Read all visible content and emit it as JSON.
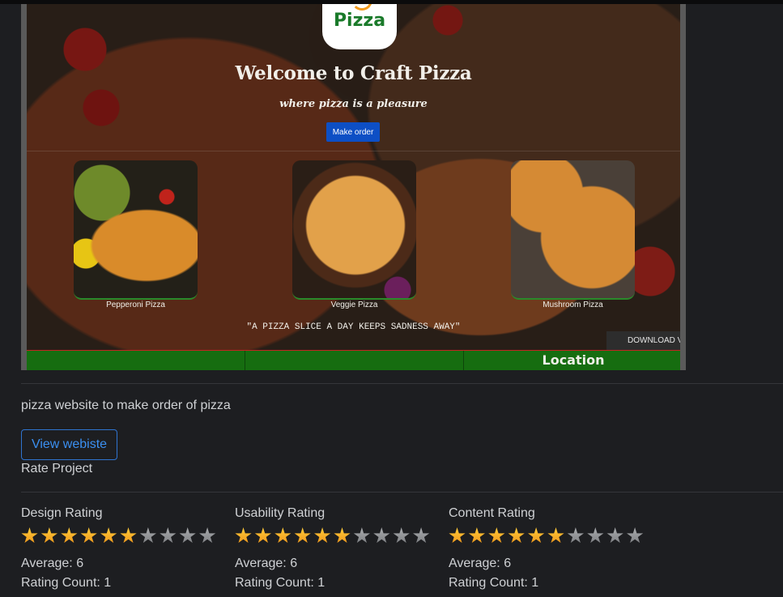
{
  "preview": {
    "logo_text": "Pizza",
    "welcome": "Welcome to Craft Pizza",
    "tagline": "where pizza is a pleasure",
    "make_order": "Make order",
    "cards": [
      {
        "label": "Pepperoni Pizza"
      },
      {
        "label": "Veggie Pizza"
      },
      {
        "label": "Mushroom Pizza"
      }
    ],
    "quote": "\"A PIZZA SLICE A DAY KEEPS SADNESS AWAY\"",
    "download": "DOWNLOAD V",
    "location": "Location"
  },
  "project": {
    "description": "pizza website to make order of pizza",
    "view_button": "View webiste",
    "rate_title": "Rate Project"
  },
  "ratings": [
    {
      "title": "Design Rating",
      "filled": 6,
      "max": 10,
      "average": "Average: 6",
      "count": "Rating Count: 1"
    },
    {
      "title": "Usability Rating",
      "filled": 6,
      "max": 10,
      "average": "Average: 6",
      "count": "Rating Count: 1"
    },
    {
      "title": "Content Rating",
      "filled": 6,
      "max": 10,
      "average": "Average: 6",
      "count": "Rating Count: 1"
    }
  ],
  "colors": {
    "background": "#1d1e21",
    "star_on": "#f7b02a",
    "star_off": "#939598",
    "link_blue": "#3b8ff0",
    "footer_green": "#166d10"
  }
}
